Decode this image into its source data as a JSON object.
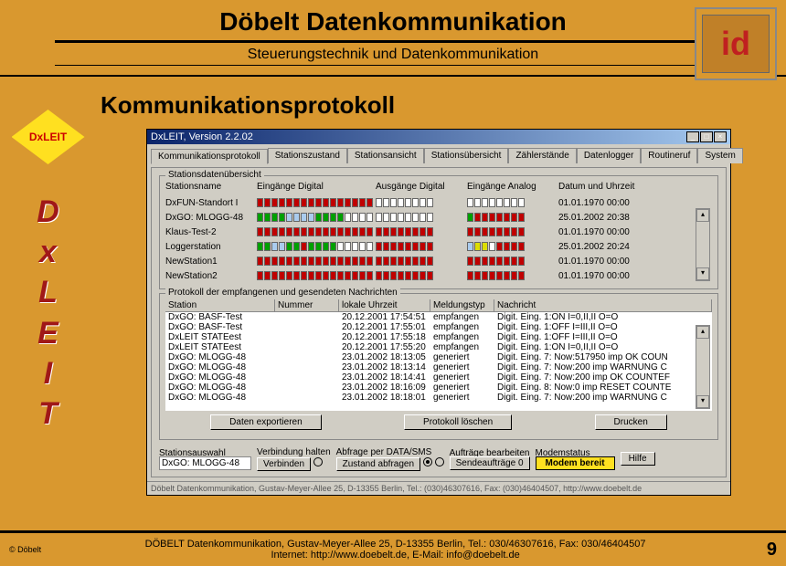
{
  "header": {
    "title": "Döbelt Datenkommunikation",
    "subtitle": "Steuerungstechnik und Datenkommunikation"
  },
  "logo": "id",
  "diamond": "DxLEIT",
  "vertical": [
    "D",
    "x",
    "L",
    "E",
    "I",
    "T"
  ],
  "page_title": "Kommunikationsprotokoll",
  "app": {
    "titlebar": "DxLEIT, Version 2.2.02",
    "tabs": [
      "Kommunikationsprotokoll",
      "Stationszustand",
      "Stationsansicht",
      "Stationsübersicht",
      "Zählerstände",
      "Datenlogger",
      "Routineruf",
      "System"
    ],
    "overview": {
      "title": "Stationsdatenübersicht",
      "cols": [
        "Stationsname",
        "Eingänge Digital",
        "Ausgänge Digital",
        "Eingänge Analog",
        "Datum und Uhrzeit"
      ],
      "rows": [
        {
          "name": "DxFUN-Standort I",
          "d1": "rrrrrrrrrrrrrrrr",
          "d2": "eeeeeeee",
          "d3": "eeeeeeee",
          "dt": "01.01.1970  00:00"
        },
        {
          "name": "DxGO: MLOGG-48",
          "d1": "ggggbbbbggggeeee",
          "d2": "eeeeeeee",
          "d3": "grrrrrrr",
          "dt": "25.01.2002  20:38"
        },
        {
          "name": "Klaus-Test-2",
          "d1": "rrrrrrrrrrrrrrrr",
          "d2": "rrrrrrrr",
          "d3": "rrrrrrrr",
          "dt": "01.01.1970  00:00"
        },
        {
          "name": "Loggerstation",
          "d1": "ggbbggrggggeeeee",
          "d2": "rrrrrrrr",
          "d3": "byyerrrr",
          "dt": "25.01.2002  20:24"
        },
        {
          "name": "NewStation1",
          "d1": "rrrrrrrrrrrrrrrr",
          "d2": "rrrrrrrr",
          "d3": "rrrrrrrr",
          "dt": "01.01.1970  00:00"
        },
        {
          "name": "NewStation2",
          "d1": "rrrrrrrrrrrrrrrr",
          "d2": "rrrrrrrr",
          "d3": "rrrrrrrr",
          "dt": "01.01.1970  00:00"
        }
      ]
    },
    "protocol": {
      "title": "Protokoll der empfangenen und gesendeten Nachrichten",
      "cols": [
        "Station",
        "Nummer",
        "lokale Uhrzeit",
        "Meldungstyp",
        "Nachricht"
      ],
      "rows": [
        {
          "s": "DxGO: BASF-Test",
          "n": "",
          "t": "20.12.2001 17:54:51",
          "m": "empfangen",
          "x": "Digit. Eing. 1:ON  I=0,II,II O=O"
        },
        {
          "s": "DxGO: BASF-Test",
          "n": "",
          "t": "20.12.2001 17:55:01",
          "m": "empfangen",
          "x": "Digit. Eing. 1:OFF I=III,II O=O"
        },
        {
          "s": "DxLEIT STATEest",
          "n": "",
          "t": "20.12.2001 17:55:18",
          "m": "empfangen",
          "x": "Digit. Eing. 1:OFF I=III,II O=O"
        },
        {
          "s": "DxLEIT STATEest",
          "n": "",
          "t": "20.12.2001 17:55:20",
          "m": "empfangen",
          "x": "Digit. Eing. 1:ON  I=0,II,II O=O"
        },
        {
          "s": "DxGO: MLOGG-48",
          "n": "",
          "t": "23.01.2002 18:13:05",
          "m": "generiert",
          "x": "Digit. Eing. 7: Now:517950 imp OK COUN"
        },
        {
          "s": "DxGO: MLOGG-48",
          "n": "",
          "t": "23.01.2002 18:13:14",
          "m": "generiert",
          "x": "Digit. Eing. 7: Now:200 imp WARNUNG C"
        },
        {
          "s": "DxGO: MLOGG-48",
          "n": "",
          "t": "23.01.2002 18:14:41",
          "m": "generiert",
          "x": "Digit. Eing. 7: Now:200 imp OK COUNTEF"
        },
        {
          "s": "DxGO: MLOGG-48",
          "n": "",
          "t": "23.01.2002 18:16:09",
          "m": "generiert",
          "x": "Digit. Eing. 8: Now:0 imp RESET COUNTE"
        },
        {
          "s": "DxGO: MLOGG-48",
          "n": "",
          "t": "23.01.2002 18:18:01",
          "m": "generiert",
          "x": "Digit. Eing. 7: Now:200 imp WARNUNG C"
        }
      ]
    },
    "buttons": {
      "export": "Daten exportieren",
      "clear": "Protokoll löschen",
      "print": "Drucken"
    },
    "bottom": {
      "sel_label": "Stationsauswahl",
      "sel_value": "DxGO: MLOGG-48",
      "conn_label": "Verbindung  halten",
      "conn_btn": "Verbinden",
      "poll_label": "Abfrage per    DATA/SMS",
      "poll_btn": "Zustand abfragen",
      "orders_label": "Aufträge bearbeiten",
      "orders_btn": "Sendeaufträge 0",
      "modem_label": "Modemstatus",
      "modem_value": "Modem bereit",
      "help": "Hilfe"
    },
    "statusbar": "Döbelt Datenkommunikation, Gustav-Meyer-Allee 25, D-13355 Berlin, Tel.: (030)46307616, Fax: (030)46404507, http://www.doebelt.de"
  },
  "footer": {
    "copyright": "© Döbelt",
    "line1": "DÖBELT Datenkommunikation, Gustav-Meyer-Allee 25, D-13355 Berlin, Tel.: 030/46307616, Fax: 030/46404507",
    "line2": "Internet: http://www.doebelt.de, E-Mail: info@doebelt.de",
    "page": "9"
  }
}
